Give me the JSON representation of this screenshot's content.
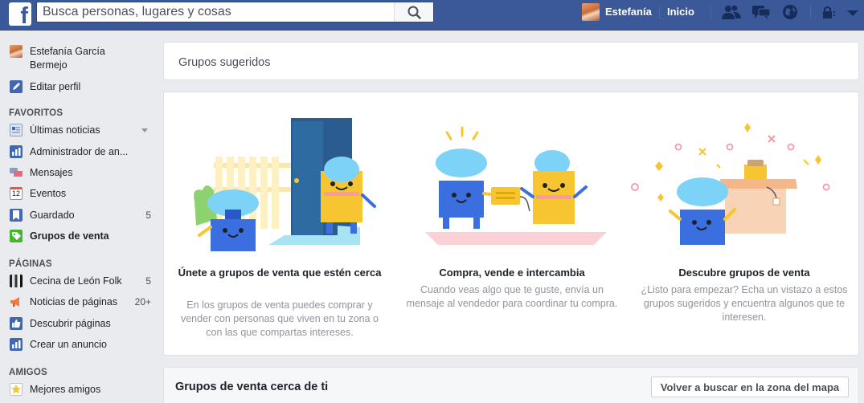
{
  "topbar": {
    "logo": "f",
    "search_placeholder": "Busca personas, lugares y cosas",
    "user_name": "Estefanía",
    "home_label": "Inicio"
  },
  "nav": {
    "profile_name_line1": "Estefanía García",
    "profile_name_line2": "Bermejo",
    "edit_profile": "Editar perfil",
    "favorites_header": "FAVORITOS",
    "favorites": [
      {
        "label": "Últimas noticias",
        "count": ""
      },
      {
        "label": "Administrador de an...",
        "count": ""
      },
      {
        "label": "Mensajes",
        "count": ""
      },
      {
        "label": "Eventos",
        "count": ""
      },
      {
        "label": "Guardado",
        "count": "5"
      },
      {
        "label": "Grupos de venta",
        "count": ""
      }
    ],
    "events_icon_number": "12",
    "pages_header": "PÁGINAS",
    "pages": [
      {
        "label": "Cecina de León Folk",
        "count": "5"
      },
      {
        "label": "Noticias de páginas",
        "count": "20+"
      },
      {
        "label": "Descubrir páginas",
        "count": ""
      },
      {
        "label": "Crear un anuncio",
        "count": ""
      }
    ],
    "friends_header": "AMIGOS",
    "friends": [
      {
        "label": "Mejores amigos",
        "count": ""
      }
    ]
  },
  "main": {
    "suggested_title": "Grupos sugeridos",
    "features": [
      {
        "title": "Únete a grupos de venta que estén cerca",
        "desc": "En los grupos de venta puedes comprar y vender con personas que viven en tu zona o con las que compartas intereses."
      },
      {
        "title": "Compra, vende e intercambia",
        "desc": "Cuando veas algo que te guste, envía un mensaje al vendedor para coordinar tu compra."
      },
      {
        "title": "Descubre grupos de venta",
        "desc": "¿Listo para empezar? Echa un vistazo a estos grupos sugeridos y encuentra algunos que te interesen."
      }
    ],
    "nearby_title": "Grupos de venta cerca de ti",
    "search_again_button": "Volver a buscar en la zona del mapa"
  },
  "colors": {
    "brand_blue": "#3b5998",
    "robot_blue": "#3b6fe0",
    "robot_yellow": "#f7c531",
    "bubble_cyan": "#7dd3f7"
  }
}
